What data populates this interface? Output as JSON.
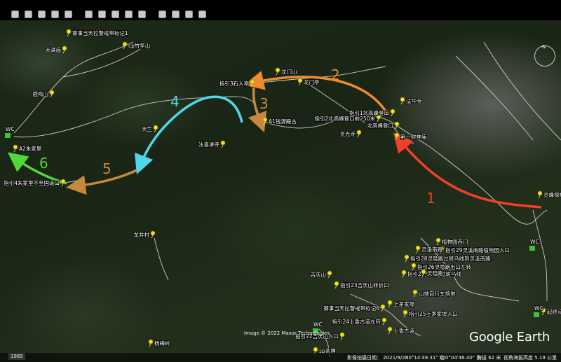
{
  "toolbar": {
    "buttons": [
      "sidebar-toggle",
      "add-placemark",
      "add-polygon",
      "add-path",
      "add-overlay",
      "record-tour",
      "historical-imagery",
      "sunlight",
      "switch-to-sky",
      "ruler",
      "email",
      "print",
      "save-image",
      "view-in-maps"
    ]
  },
  "compass": {
    "north_label": "N"
  },
  "routes": [
    {
      "number": "1",
      "color": "#f0402a"
    },
    {
      "number": "2",
      "color": "#f08a2e"
    },
    {
      "number": "3",
      "color": "#c5883e"
    },
    {
      "number": "4",
      "color": "#4fd6e8"
    },
    {
      "number": "5",
      "color": "#c5883e"
    },
    {
      "number": "6",
      "color": "#52d63a"
    }
  ],
  "places": [
    "赛事当天拉警戒带标记1",
    "cp竹竿山",
    "大满庙",
    "鹿鸣山",
    "A2朱家里",
    "指引4朱家里下至国道口",
    "天竺",
    "法喜讲寺",
    "指引3石人亭",
    "A1钱源殿古",
    "龙门山",
    "龙门亭",
    "法华寺",
    "指引2北高峰登口前250米",
    "指引1北高峰登口",
    "北高峰登口",
    "灵光寺",
    "第一财神庙",
    "灵峰探梅",
    "龙井村",
    "植物园西门",
    "指引29灵溪南路植物园入口",
    "灵溪南路",
    "指引28灵隐路过斑马线到灵溪南路",
    "指引26灵隐路出口左转",
    "指引27灵隐路过斑马线",
    "灵隐路",
    "吉庆山",
    "指引23吉庆山转折口",
    "山地自行车场地",
    "上茅家埠",
    "赛事当天拉警戒带标记6",
    "指引25上茅家埠入口",
    "指引24上香古道左转",
    "上香古道",
    "指引22吉庆山入口",
    "sp茶博",
    "杨梅岭",
    "起终点"
  ],
  "wc_label": "WC",
  "credit": "Image © 2022 Maxar Technologies",
  "logo": "Google Earth",
  "status": {
    "year": "1985",
    "imagery_date": "影像拍摄日期：  2021/9/28",
    "lat": "30°14'49.31\" 北",
    "lon": "120°04'46.40\" 东",
    "elevation": "海拔  62 米",
    "eye_alt": "视角海拔高度  5.19 公里"
  }
}
